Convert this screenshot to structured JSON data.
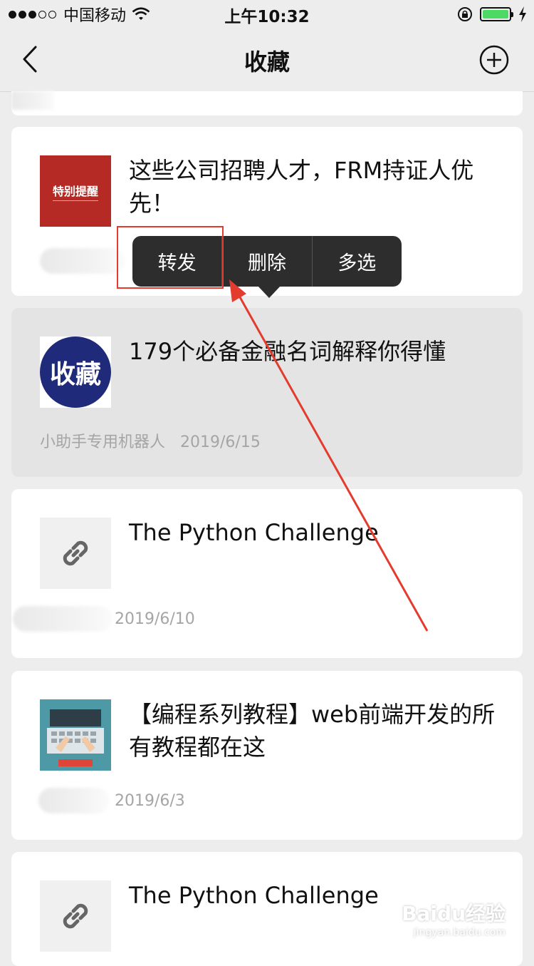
{
  "status_bar": {
    "carrier": "中国移动",
    "time": "上午10:32",
    "battery_level": 1.0
  },
  "nav": {
    "title": "收藏",
    "back_icon": "chevron-left-icon",
    "add_icon": "plus-circle-icon"
  },
  "items": [
    {
      "title": "这些公司招聘人才，FRM持证人优先！",
      "thumb_text": "特别提醒",
      "thumb_color": "#b52a24"
    },
    {
      "title": "179个必备金融名词解释你得懂",
      "thumb_text": "收藏",
      "thumb_color": "#1f2a7a",
      "source": "小助手专用机器人",
      "date": "2019/6/15"
    },
    {
      "title": "The Python Challenge",
      "thumb_icon": "link-icon",
      "date": "2019/6/10"
    },
    {
      "title": "【编程系列教程】web前端开发的所有教程都在这",
      "date": "2019/6/3"
    },
    {
      "title": "The Python Challenge",
      "thumb_icon": "link-icon"
    }
  ],
  "context_menu": {
    "items": [
      "转发",
      "删除",
      "多选"
    ],
    "highlighted": "转发"
  },
  "annotation_color": "#e33b2e",
  "watermark": {
    "main": "Baidu经验",
    "sub": "jingyan.baidu.com"
  }
}
